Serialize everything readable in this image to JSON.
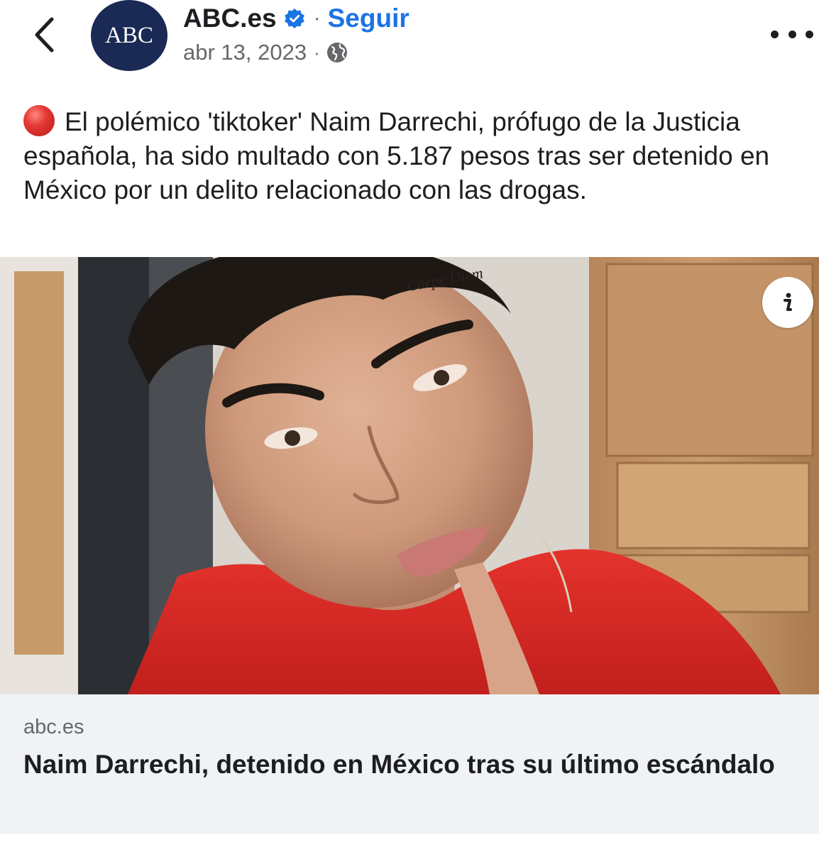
{
  "header": {
    "avatar_text": "ABC",
    "page_name": "ABC.es",
    "separator": "·",
    "follow_label": "Seguir",
    "date": "abr 13, 2023",
    "meta_separator": "·",
    "icons": {
      "back": "chevron-left-icon",
      "verified": "verified-badge-icon",
      "audience": "globe-icon",
      "more": "more-options-icon"
    }
  },
  "post": {
    "text": "El polémico 'tiktoker' Naim Darrechi, prófugo de la Justicia española, ha sido  multado con 5.187 pesos tras ser detenido en México por un delito relacionado con las drogas.",
    "emoji": "red-circle-emoji"
  },
  "link_preview": {
    "domain": "abc.es",
    "title": "Naim Darrechi, detenido en México tras su último escándalo",
    "info_icon": "info-icon"
  },
  "colors": {
    "brand_avatar": "#1a2a55",
    "follow_blue": "#1b74e4",
    "verified_blue": "#1b74e4",
    "card_background": "#f0f2f5",
    "secondary_text": "#65676b"
  }
}
